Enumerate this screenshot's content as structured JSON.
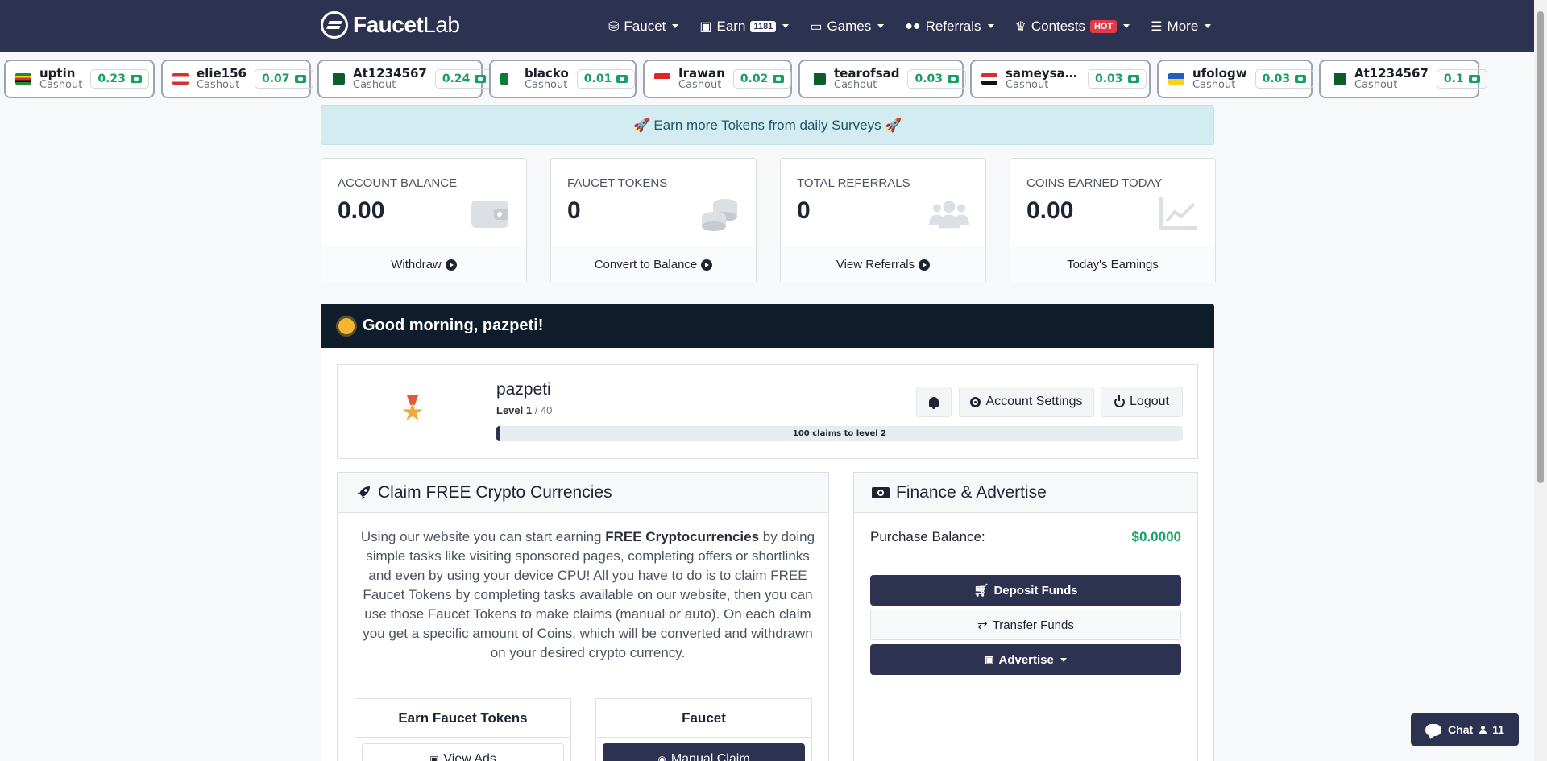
{
  "brand": {
    "name_bold": "Faucet",
    "name_light": "Lab"
  },
  "nav": {
    "items": [
      {
        "label": "Faucet",
        "icon": "coins-icon"
      },
      {
        "label": "Earn",
        "icon": "money-icon",
        "badge": "1181"
      },
      {
        "label": "Games",
        "icon": "gamepad-icon"
      },
      {
        "label": "Referrals",
        "icon": "users-icon"
      },
      {
        "label": "Contests",
        "icon": "trophy-icon",
        "badge": "HOT"
      },
      {
        "label": "More",
        "icon": "menu-icon"
      }
    ]
  },
  "ticker": [
    {
      "user": "uptin",
      "label": "Cashout",
      "amount": "0.23",
      "flag": "zimbabwe"
    },
    {
      "user": "elie156",
      "label": "Cashout",
      "amount": "0.07",
      "flag": "lebanon"
    },
    {
      "user": "At1234567",
      "label": "Cashout",
      "amount": "0.24",
      "flag": "pakistan"
    },
    {
      "user": "blacko",
      "label": "Cashout",
      "amount": "0.01",
      "flag": "algeria"
    },
    {
      "user": "Irawan",
      "label": "Cashout",
      "amount": "0.02",
      "flag": "indonesia"
    },
    {
      "user": "tearofsad",
      "label": "Cashout",
      "amount": "0.03",
      "flag": "pakistan"
    },
    {
      "user": "sameysalem...",
      "label": "Cashout",
      "amount": "0.03",
      "flag": "egypt"
    },
    {
      "user": "ufologw",
      "label": "Cashout",
      "amount": "0.03",
      "flag": "ukraine"
    },
    {
      "user": "At1234567",
      "label": "Cashout",
      "amount": "0.1",
      "flag": "pakistan"
    }
  ],
  "alert": {
    "text": "🚀 Earn more Tokens from daily Surveys 🚀"
  },
  "stats": [
    {
      "title": "ACCOUNT BALANCE",
      "value": "0.00",
      "icon": "wallet-icon",
      "footer": "Withdraw"
    },
    {
      "title": "FAUCET TOKENS",
      "value": "0",
      "icon": "coins-stack-icon",
      "footer": "Convert to Balance"
    },
    {
      "title": "TOTAL REFERRALS",
      "value": "0",
      "icon": "users-icon",
      "footer": "View Referrals"
    },
    {
      "title": "COINS EARNED TODAY",
      "value": "0.00",
      "icon": "chart-line-icon",
      "footer": "Today's Earnings"
    }
  ],
  "greeting": {
    "text": "Good morning, pazpeti!"
  },
  "profile": {
    "username": "pazpeti",
    "level_label": "Level 1",
    "level_max": "/ 40",
    "progress_fraction": 0.005,
    "progress_text": "100 claims to level 2",
    "account_settings": "Account Settings",
    "logout": "Logout"
  },
  "claim": {
    "title": "Claim FREE Crypto Currencies",
    "desc_1": "Using our website you can start earning ",
    "desc_bold": "FREE Cryptocurrencies",
    "desc_2": " by doing simple tasks like visiting sponsored pages, completing offers or shortlinks and even by using your device CPU! All you have to do is to claim FREE Faucet Tokens by completing tasks available on our website, then you can use those Faucet Tokens to make claims (manual or auto). On each claim you get a specific amount of Coins, which will be converted and withdrawn on your desired crypto currency.",
    "earn_tokens_title": "Earn Faucet Tokens",
    "view_ads": "View Ads",
    "faucet_title": "Faucet",
    "manual_claim": "Manual Claim"
  },
  "finance": {
    "title": "Finance & Advertise",
    "purchase_label": "Purchase Balance:",
    "purchase_value": "$0.0000",
    "deposit": "Deposit Funds",
    "transfer": "Transfer Funds",
    "advertise": "Advertise"
  },
  "chat": {
    "label": "Chat",
    "online": "11"
  },
  "colors": {
    "nav_bg": "#2d3250",
    "accent_green": "#16a062",
    "greeting_bg": "#0f1d2b",
    "hot_badge": "#e23b4a"
  }
}
